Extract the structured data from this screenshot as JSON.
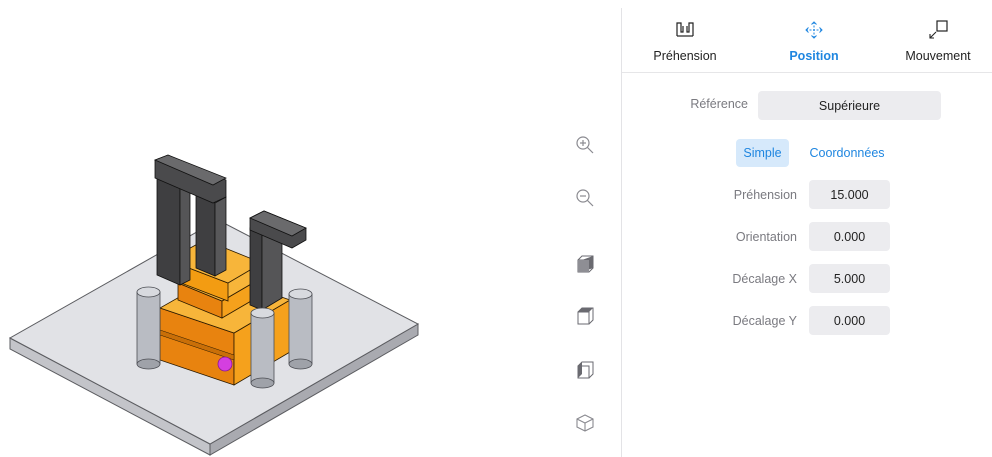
{
  "tabs": [
    {
      "label": "Préhension",
      "icon": "gripper-icon",
      "active": false
    },
    {
      "label": "Position",
      "icon": "move-arrows-icon",
      "active": true
    },
    {
      "label": "Mouvement",
      "icon": "motion-arrow-icon",
      "active": false
    }
  ],
  "reference": {
    "label": "Référence",
    "value": "Supérieure"
  },
  "modes": {
    "simple": "Simple",
    "coordinates": "Coordonnées",
    "active": "Simple"
  },
  "fields": [
    {
      "label": "Préhension",
      "value": "15.000"
    },
    {
      "label": "Orientation",
      "value": "0.000"
    },
    {
      "label": "Décalage X",
      "value": "5.000"
    },
    {
      "label": "Décalage Y",
      "value": "0.000"
    }
  ],
  "view_tools": [
    "zoom-in-icon",
    "zoom-out-icon",
    "view-top-cube-icon",
    "view-front-cube-icon",
    "view-side-cube-icon",
    "view-iso-cube-icon"
  ],
  "colors": {
    "accent": "#1f86e0",
    "part": "#f39c12",
    "gripper": "#4a4a4c",
    "marker": "#d43fe0",
    "plate": "#dcdde2"
  }
}
